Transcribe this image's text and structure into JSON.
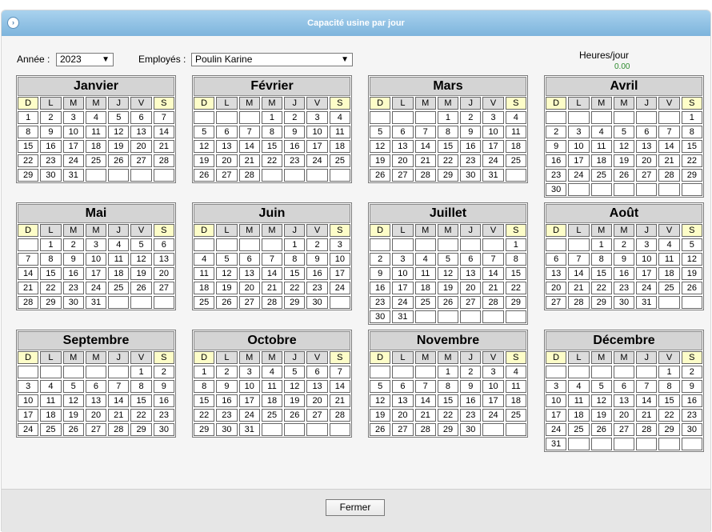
{
  "dialog": {
    "title": "Capacité usine par jour",
    "close_label": "Fermer"
  },
  "filters": {
    "year_label": "Année :",
    "year_value": "2023",
    "employee_label": "Employés :",
    "employee_value": "Poulin Karine",
    "hours_label": "Heures/jour",
    "hours_value": "0.00"
  },
  "day_headers": [
    "D",
    "L",
    "M",
    "M",
    "J",
    "V",
    "S"
  ],
  "months": [
    {
      "name": "Janvier",
      "start": 0,
      "days": 31
    },
    {
      "name": "Février",
      "start": 3,
      "days": 28
    },
    {
      "name": "Mars",
      "start": 3,
      "days": 31
    },
    {
      "name": "Avril",
      "start": 6,
      "days": 30
    },
    {
      "name": "Mai",
      "start": 1,
      "days": 31
    },
    {
      "name": "Juin",
      "start": 4,
      "days": 30
    },
    {
      "name": "Juillet",
      "start": 6,
      "days": 31
    },
    {
      "name": "Août",
      "start": 2,
      "days": 31
    },
    {
      "name": "Septembre",
      "start": 5,
      "days": 30
    },
    {
      "name": "Octobre",
      "start": 0,
      "days": 31
    },
    {
      "name": "Novembre",
      "start": 3,
      "days": 30
    },
    {
      "name": "Décembre",
      "start": 5,
      "days": 31
    }
  ]
}
